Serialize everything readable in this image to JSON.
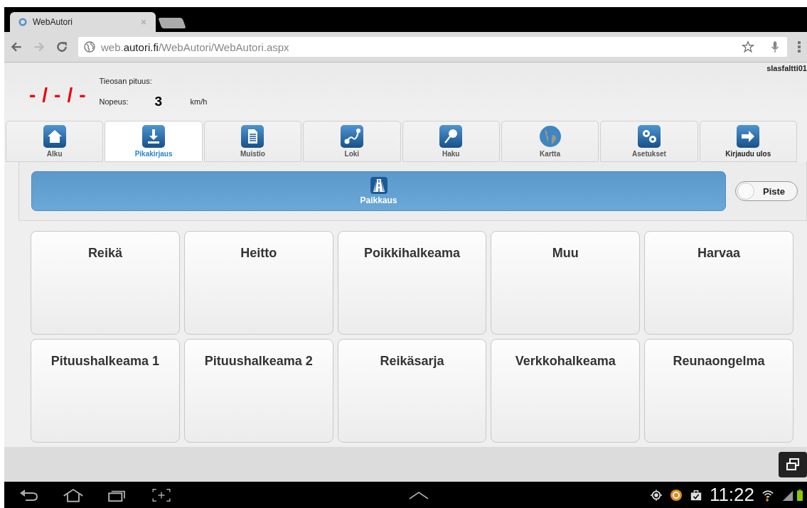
{
  "browser": {
    "tab_title": "WebAutori",
    "url_prefix": "web.",
    "url_domain": "autori.fi",
    "url_path": "/WebAutori/WebAutori.aspx"
  },
  "header": {
    "user": "slasfaltti01",
    "position": "-/-/-",
    "length_label": "Tieosan pituus:",
    "speed_label": "Nopeus:",
    "speed_value": "3",
    "speed_unit": "km/h"
  },
  "tabs": [
    {
      "label": "Alku",
      "selected": false
    },
    {
      "label": "Pikakirjaus",
      "selected": true
    },
    {
      "label": "Muistio",
      "selected": false
    },
    {
      "label": "Loki",
      "selected": false
    },
    {
      "label": "Haku",
      "selected": false
    },
    {
      "label": "Kartta",
      "selected": false
    },
    {
      "label": "Asetukset",
      "selected": false
    },
    {
      "label": "Kirjaudu ulos",
      "selected": false
    }
  ],
  "category": {
    "label": "Paikkaus"
  },
  "toggle": {
    "label": "Piste",
    "on": false
  },
  "buttons": [
    {
      "label": "Reikä"
    },
    {
      "label": "Heitto"
    },
    {
      "label": "Poikkihalkeama"
    },
    {
      "label": "Muu"
    },
    {
      "label": "Harvaa"
    },
    {
      "label": "Pituushalkeama 1"
    },
    {
      "label": "Pituushalkeama 2"
    },
    {
      "label": "Reikäsarja"
    },
    {
      "label": "Verkkohalkeama"
    },
    {
      "label": "Reunaongelma"
    }
  ],
  "status_bar": {
    "time": "11:22"
  }
}
